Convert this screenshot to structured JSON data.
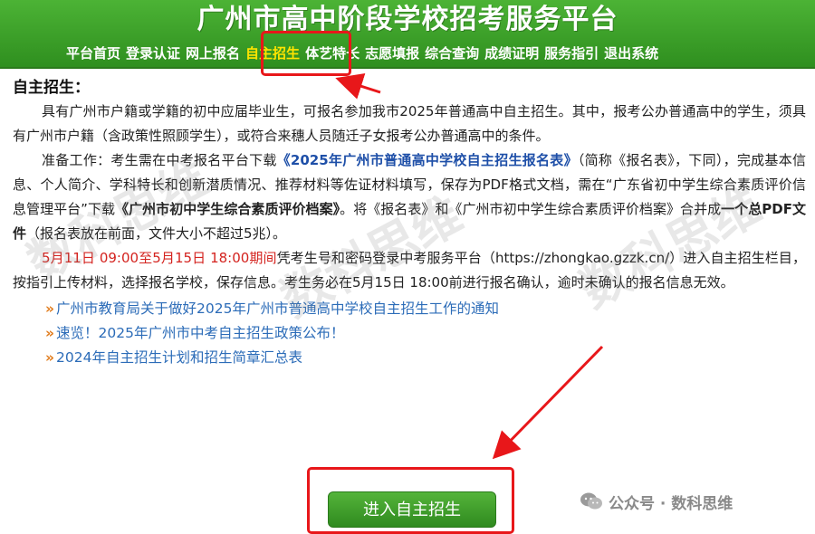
{
  "header": {
    "title": "广州市高中阶段学校招考服务平台",
    "nav": [
      {
        "label": "平台首页"
      },
      {
        "label": "登录认证"
      },
      {
        "label": "网上报名"
      },
      {
        "label": "自主招生",
        "active": true
      },
      {
        "label": "体艺特长"
      },
      {
        "label": "志愿填报"
      },
      {
        "label": "综合查询"
      },
      {
        "label": "成绩证明"
      },
      {
        "label": "服务指引"
      },
      {
        "label": "退出系统"
      }
    ]
  },
  "main": {
    "section_title": "自主招生：",
    "para1": "具有广州市户籍或学籍的初中应届毕业生，可报名参加我市2025年普通高中自主招生。其中，报考公办普通高中的学生，须具有广州市户籍（含政策性照顾学生），或符合来穗人员随迁子女报考公办普通高中的条件。",
    "para2": {
      "t1": "准备工作：考生需在中考报名平台下载",
      "b1": "《2025年广州市普通高中学校自主招生报名表》",
      "t2": "（简称《报名表》，下同），完成基本信息、个人简介、学科特长和创新潜质情况、推荐材料等佐证材料填写，保存为PDF格式文档，需在“广东省初中学生综合素质评价信息管理平台”下载",
      "b2": "《广州市初中学生综合素质评价档案》",
      "t3": "。将《报名表》和《广州市初中学生综合素质评价档案》合并成",
      "b3": "一个总PDF文件",
      "t4": "（报名表放在前面，文件大小不超过5兆）。"
    },
    "para3": {
      "red": "5月11日 09:00至5月15日 18:00期间",
      "t1": "凭考生号和密码登录中考服务平台（https://zhongkao.gzzk.cn/）进入自主招生栏目，按指引上传材料，选择报名学校，保存信息。考生务必在5月15日 18:00前进行报名确认，逾时未确认的报名信息无效。"
    },
    "links": [
      {
        "label": "广州市教育局关于做好2025年广州市普通高中学校自主招生工作的通知"
      },
      {
        "label": "速览！2025年广州市中考自主招生政策公布！"
      },
      {
        "label": "2024年自主招生计划和招生简章汇总表"
      }
    ],
    "enter_button": "进入自主招生"
  },
  "overlay": {
    "watermark": "数科思维",
    "credit": "公众号 · 数科思维",
    "colors": {
      "header_green": "#3ea52a",
      "highlight_red": "#e8171a",
      "link_blue": "#2c6cb8",
      "nav_active": "#ffe400"
    }
  }
}
